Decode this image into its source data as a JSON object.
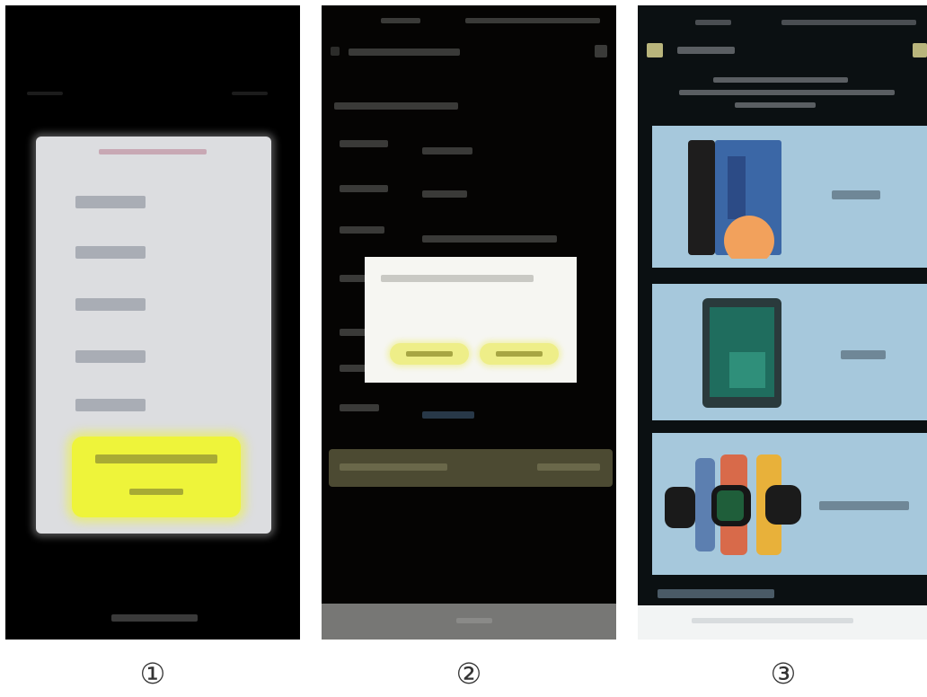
{
  "captions": [
    "①",
    "②",
    "③"
  ],
  "colors": {
    "highlight": "#eef43a",
    "dark_background": "#000000",
    "card_blue": "#a6c8dc"
  },
  "icons": [
    "phone-product-image",
    "tablet-product-image",
    "smartwatch-product-image"
  ]
}
